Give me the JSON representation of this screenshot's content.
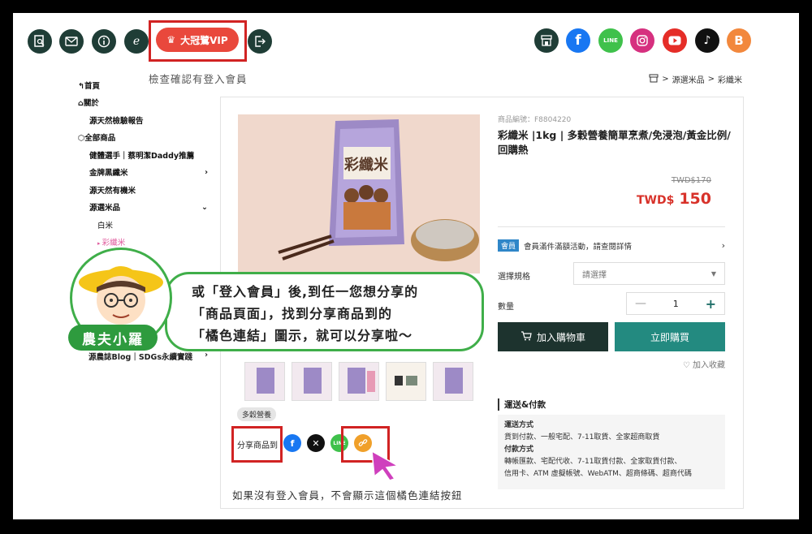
{
  "toolbar": {
    "vip_label": "大冠鷺VIP",
    "note": "檢查確認有登入會員"
  },
  "breadcrumb": [
    "源選米品",
    "彩纖米"
  ],
  "sidebar": {
    "items": [
      {
        "label": "首頁",
        "icon": "back-arrow-icon"
      },
      {
        "label": "關於",
        "icon": "home-icon"
      },
      {
        "label": "源天然檢驗報告"
      },
      {
        "label": "全部商品",
        "icon": "cube-icon"
      },
      {
        "label": "健體選手｜蔡明潔Daddy推薦"
      },
      {
        "label": "金牌黑纖米",
        "chevron": "›"
      },
      {
        "label": "源天然有機米"
      },
      {
        "label": "源選米品",
        "chevron": "⌄"
      },
      {
        "label": "白米"
      },
      {
        "label": "彩纖米"
      }
    ],
    "blog": "源農誌Blog｜SDGs永續實踐"
  },
  "product": {
    "sku": "商品編號：F8804220",
    "title": "彩纖米 |1kg | 多穀營養簡單烹煮/免浸泡/黃金比例/回購熱",
    "old_price": "TWD$170",
    "currency": "TWD$",
    "price": "150",
    "member_badge": "會員",
    "member_text": "會員滿件滿額活動，請查閱詳情",
    "spec_label": "選擇規格",
    "spec_placeholder": "請選擇",
    "qty_label": "數量",
    "qty_value": "1",
    "cart_label": "加入購物車",
    "buy_label": "立即購買",
    "fav_label": "加入收藏",
    "tag": "多穀營養",
    "share_label": "分享商品到",
    "package_text": "彩纖米"
  },
  "shipping": {
    "heading": "運送&付款",
    "method_title": "運送方式",
    "method_text": "貨到付款、一般宅配、7-11取貨、全家超商取貨",
    "pay_title": "付款方式",
    "pay_text1": "轉帳匯款、宅配代收、7-11取貨付款、全家取貨付款、",
    "pay_text2": "信用卡、ATM 虛擬帳號、WebATM、超商條碼、超商代碼"
  },
  "callout": {
    "line1": "或「登入會員」後,到任一您想分享的",
    "line2": "「商品頁面」，找到分享商品到的",
    "line3": "「橘色連結」圖示，就可以分享啦～",
    "farmer_name": "農夫小羅"
  },
  "bottom_note": "如果沒有登入會員，不會顯示這個橘色連結按鈕",
  "colors": {
    "accent_dark": "#1d332e",
    "accent_teal": "#238a80",
    "price_red": "#d8322a",
    "highlight_red": "#d12323",
    "link_orange": "#f0a02a",
    "callout_green": "#3fae49"
  }
}
